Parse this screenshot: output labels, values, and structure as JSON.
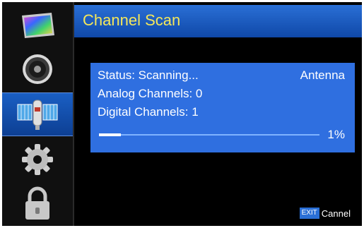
{
  "sidebar": {
    "items": [
      {
        "icon": "picture-icon",
        "active": false
      },
      {
        "icon": "speaker-icon",
        "active": false
      },
      {
        "icon": "satellite-icon",
        "active": true
      },
      {
        "icon": "gear-icon",
        "active": false
      },
      {
        "icon": "lock-icon",
        "active": false
      }
    ]
  },
  "header": {
    "title": "Channel Scan"
  },
  "scan": {
    "status": "Status: Scanning...",
    "source": "Antenna",
    "analog": "Analog Channels: 0",
    "digital": "Digital Channels: 1",
    "progress_percent": 1,
    "progress_label": "1%"
  },
  "footer": {
    "exit_key": "EXIT",
    "exit_label": "Cannel"
  },
  "colors": {
    "header": "#1c5cc4",
    "title": "#f5e75a",
    "panel": "#2f6fe0",
    "background": "#000000"
  }
}
